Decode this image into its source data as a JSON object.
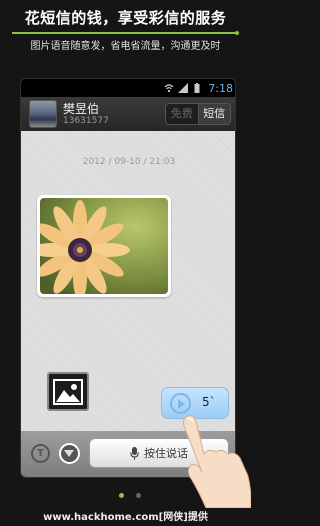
{
  "promo": {
    "title": "花短信的钱，享受彩信的服务",
    "subtitle": "图片语音随意发，省电省流量，沟通更及时"
  },
  "status_bar": {
    "time": "7:18"
  },
  "chat_header": {
    "contact_name": "樊昱伯",
    "contact_phone": "13631577",
    "mode_free": "免费",
    "mode_sms": "短信"
  },
  "chat": {
    "timestamp": "2012 / 09-10 / 21:03",
    "voice_duration": "5`"
  },
  "input_bar": {
    "text_mode_icon": "T",
    "hold_to_talk": "按住说话"
  },
  "watermark": "www.hackhome.com[网侠]提供",
  "colors": {
    "accent_green": "#8cc23f",
    "voice_bubble": "#b4dafc",
    "status_time": "#63b5ef"
  },
  "icons": [
    "signal-icon",
    "wifi-icon",
    "battery-icon",
    "play-icon",
    "microphone-icon",
    "image-icon",
    "text-mode-icon",
    "expand-icon"
  ]
}
